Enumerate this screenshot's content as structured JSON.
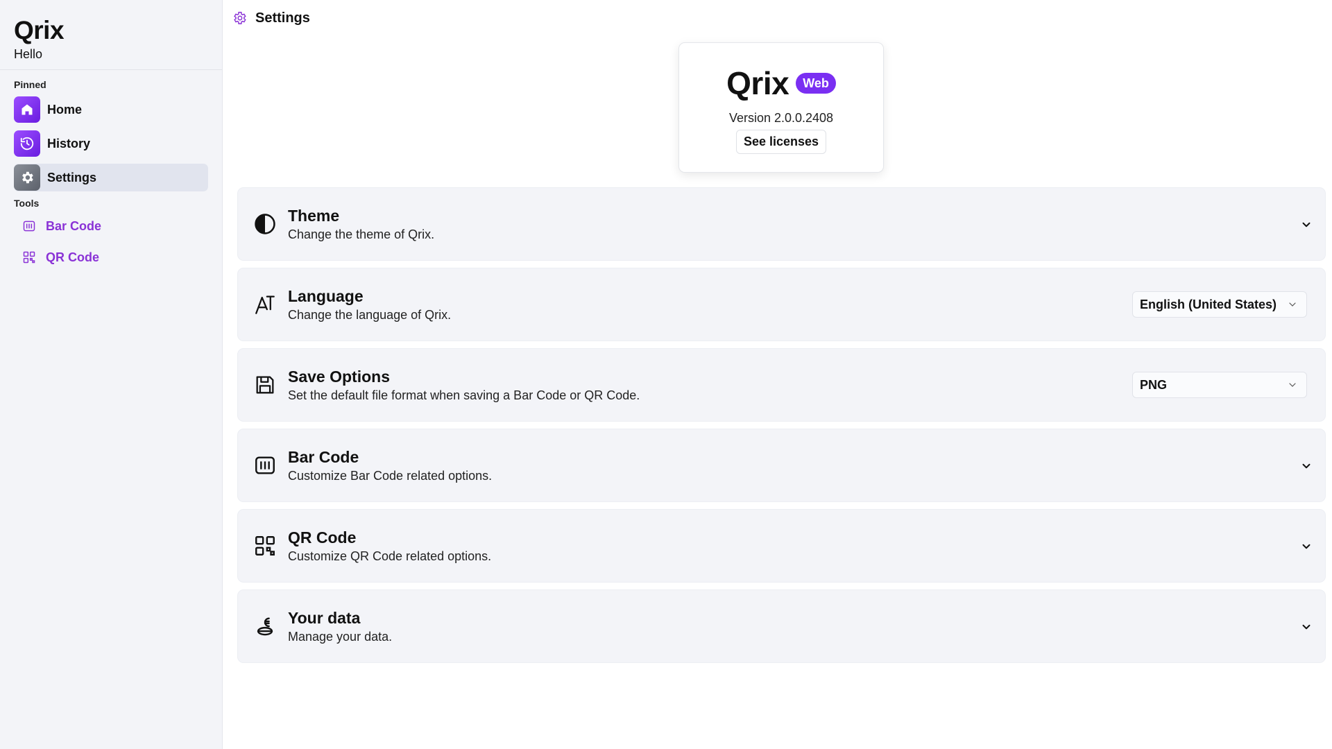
{
  "app": {
    "name": "Qrix",
    "greeting": "Hello"
  },
  "sidebar": {
    "pinned_label": "Pinned",
    "pinned": [
      {
        "label": "Home",
        "icon": "home-icon",
        "active": false
      },
      {
        "label": "History",
        "icon": "history-icon",
        "active": false
      },
      {
        "label": "Settings",
        "icon": "gear-icon",
        "active": true
      }
    ],
    "tools_label": "Tools",
    "tools": [
      {
        "label": "Bar Code",
        "icon": "barcode-icon"
      },
      {
        "label": "QR Code",
        "icon": "qrcode-icon"
      }
    ]
  },
  "header": {
    "title": "Settings",
    "icon": "gear-icon"
  },
  "about": {
    "name": "Qrix",
    "badge": "Web",
    "version": "Version 2.0.0.2408",
    "licenses_button": "See licenses"
  },
  "settings": [
    {
      "title": "Theme",
      "desc": "Change the theme of Qrix.",
      "icon": "contrast-icon",
      "control": "chevron"
    },
    {
      "title": "Language",
      "desc": "Change the language of Qrix.",
      "icon": "language-icon",
      "control": "select",
      "value": "English (United States)"
    },
    {
      "title": "Save Options",
      "desc": "Set the default file format when saving a Bar Code or QR Code.",
      "icon": "save-icon",
      "control": "select",
      "value": "PNG"
    },
    {
      "title": "Bar Code",
      "desc": "Customize Bar Code related options.",
      "icon": "barcode-icon",
      "control": "chevron"
    },
    {
      "title": "QR Code",
      "desc": "Customize QR Code related options.",
      "icon": "qrcode-icon",
      "control": "chevron"
    },
    {
      "title": "Your data",
      "desc": "Manage your data.",
      "icon": "data-icon",
      "control": "chevron"
    }
  ],
  "colors": {
    "accent": "#7a2ff2",
    "tool_text": "#8a32d6",
    "sidebar_bg": "#f3f4f8",
    "row_bg": "#f3f4f8"
  }
}
